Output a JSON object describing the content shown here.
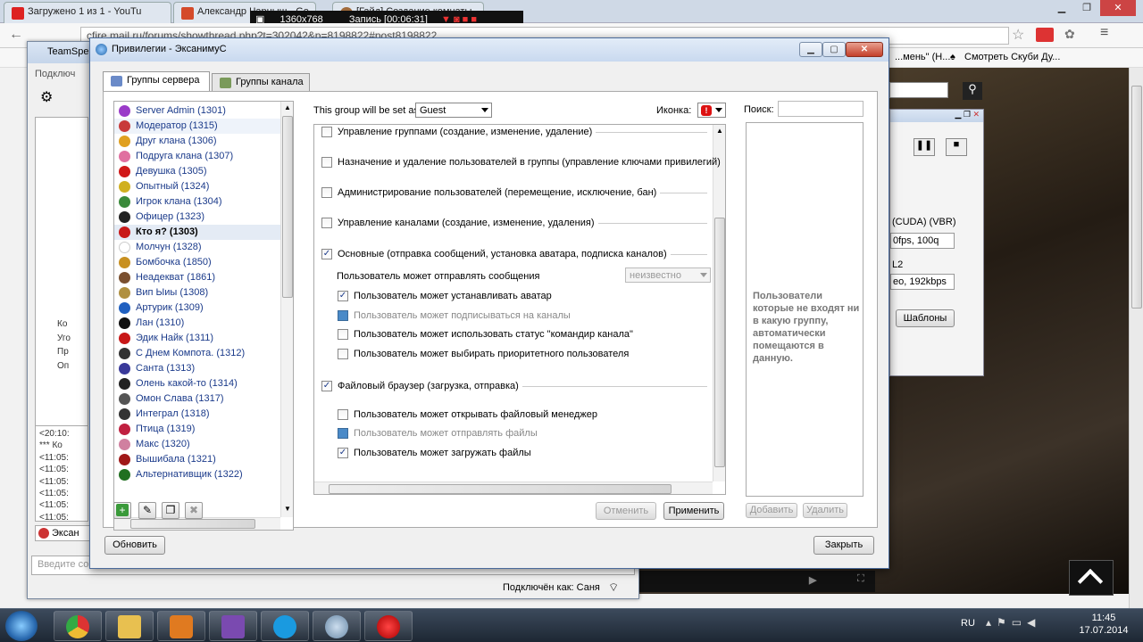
{
  "browser": {
    "tabs": [
      "Загружено 1 из 1 - YouTu",
      "Александр Чарныш - Go",
      "[Гайд] Создание комнаты"
    ],
    "url": "cfire.mail.ru/forums/showthread.php?t=302042&p=8198822#post8198822",
    "bookmarks": [
      "...мень\" (Н...",
      "Смотреть Скуби Ду..."
    ],
    "recorder": {
      "resolution": "1360x768",
      "recording": "Запись [00:06:31]"
    }
  },
  "teamspeak": {
    "title": "TeamSpe",
    "tab": "Подключ",
    "status": "Подключён как: Саня",
    "chat_placeholder": "Введите со",
    "log": [
      "<20:10:",
      "*** Ко",
      "<11:05:",
      "<11:05:",
      "<11:05:",
      "<11:05:",
      "<11:05:",
      "<11:05:"
    ],
    "tree_labels": [
      "Ко",
      "Уго",
      "Пр",
      "Оп"
    ],
    "bottom_tab": "Эксан"
  },
  "background_window": {
    "encoder": "(CUDA) (VBR)",
    "fps": "0fps, 100q",
    "l2": "L2",
    "audio": "eo, 192kbps",
    "templates": "Шаблоны"
  },
  "dialog": {
    "title": "Привилегии - ЭксанимуС",
    "tabs": [
      "Группы сервера",
      "Группы канала"
    ],
    "groups": [
      {
        "name": "Server Admin (1301)",
        "color": "#9a3ac8"
      },
      {
        "name": "Модератор (1315)",
        "color": "#c83a3a"
      },
      {
        "name": "Друг клана (1306)",
        "color": "#e0a020"
      },
      {
        "name": "Подруга клана (1307)",
        "color": "#e070a0"
      },
      {
        "name": "Девушка (1305)",
        "color": "#d01818"
      },
      {
        "name": "Опытный (1324)",
        "color": "#d0b020"
      },
      {
        "name": "Игрок клана (1304)",
        "color": "#3a8a3a"
      },
      {
        "name": "Офицер (1323)",
        "color": "#222222"
      },
      {
        "name": "Кто я? (1303)",
        "color": "#c81818"
      },
      {
        "name": "Молчун (1328)",
        "color": "#ffffff"
      },
      {
        "name": "Бомбочка (1850)",
        "color": "#c89020"
      },
      {
        "name": "Неадекват (1861)",
        "color": "#7a5030"
      },
      {
        "name": "Вип Ыиы (1308)",
        "color": "#b09040"
      },
      {
        "name": "Артурик (1309)",
        "color": "#2060c0"
      },
      {
        "name": "Лан (1310)",
        "color": "#111111"
      },
      {
        "name": "Эдик Найк (1311)",
        "color": "#c81818"
      },
      {
        "name": "С Днем Компота. (1312)",
        "color": "#333333"
      },
      {
        "name": "Санта (1313)",
        "color": "#3a3a9a"
      },
      {
        "name": "Олень какой-то (1314)",
        "color": "#222222"
      },
      {
        "name": "Омон Слава (1317)",
        "color": "#555555"
      },
      {
        "name": "Интеграл (1318)",
        "color": "#333333"
      },
      {
        "name": "Птица (1319)",
        "color": "#c02040"
      },
      {
        "name": "Макс (1320)",
        "color": "#d080a0"
      },
      {
        "name": "Вышибала (1321)",
        "color": "#a01818"
      },
      {
        "name": "Альтернативщик (1322)",
        "color": "#207020"
      }
    ],
    "selected_group": "Кто я? (1303)",
    "set_as_label": "This group will be set as:",
    "set_as_value": "Guest",
    "icon_label": "Иконка:",
    "perms": [
      {
        "label": "Управление группами (создание, изменение, удаление)",
        "checked": false
      },
      {
        "label": "Назначение и удаление пользователей в группы (управление ключами привилегий)",
        "checked": false
      },
      {
        "label": "Администрирование пользователей (перемещение, исключение, бан)",
        "checked": false
      },
      {
        "label": "Управление каналами (создание, изменение, удаления)",
        "checked": false
      },
      {
        "label": "Основные (отправка сообщений, установка аватара, подписка каналов)",
        "checked": true
      },
      {
        "label": "Файловый браузер (загрузка, отправка)",
        "checked": true
      }
    ],
    "subperms_basic": [
      {
        "label": "Пользователь может устанавливать аватар",
        "state": "checked"
      },
      {
        "label": "Пользователь может подписываться на каналы",
        "state": "filled"
      },
      {
        "label": "Пользователь может использовать статус \"командир канала\"",
        "state": "unchecked"
      },
      {
        "label": "Пользователь может выбирать приоритетного пользователя",
        "state": "unchecked"
      }
    ],
    "send_msg_label": "Пользователь может отправлять сообщения",
    "send_msg_value": "неизвестно",
    "subperms_files": [
      {
        "label": "Пользователь может открывать файловый менеджер",
        "state": "unchecked"
      },
      {
        "label": "Пользователь может отправлять файлы",
        "state": "filled"
      },
      {
        "label": "Пользователь может загружать файлы",
        "state": "checked"
      }
    ],
    "cancel": "Отменить",
    "apply": "Применить",
    "search_label": "Поиск:",
    "note": "Пользователи которые не входят ни в какую группу, автоматически помещаются в данную.",
    "add": "Добавить",
    "remove": "Удалить",
    "refresh": "Обновить",
    "close": "Закрыть"
  },
  "taskbar": {
    "lang": "RU",
    "time": "11:45",
    "date": "17.07.2014"
  }
}
